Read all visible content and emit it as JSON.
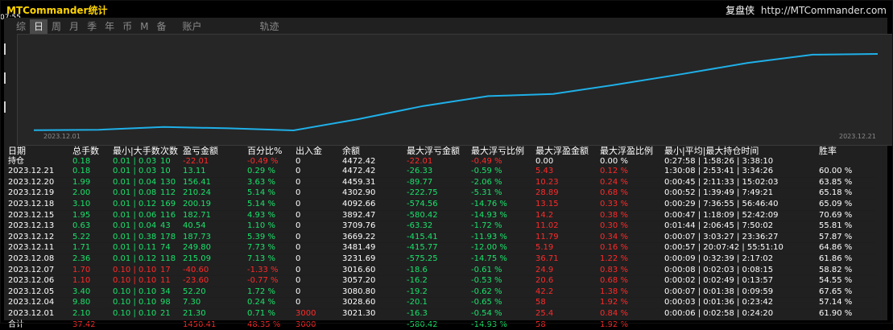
{
  "window": {
    "title": "MTCommander统计",
    "clock": "07:55",
    "brand_cn": "复盘侠",
    "brand_url": "http://MTCommander.com"
  },
  "tabs": [
    {
      "label": "综",
      "active": false
    },
    {
      "label": "日",
      "active": true
    },
    {
      "label": "周",
      "active": false
    },
    {
      "label": "月",
      "active": false
    },
    {
      "label": "季",
      "active": false
    },
    {
      "label": "年",
      "active": false
    },
    {
      "label": "币",
      "active": false
    },
    {
      "label": "M",
      "active": false
    },
    {
      "label": "备",
      "active": false
    },
    {
      "label": "账户",
      "active": false
    },
    {
      "label": "轨迹",
      "active": false
    }
  ],
  "chart": {
    "start_label": "2023.12.01",
    "end_label": "2023.12.21",
    "line_color": "#1fb0e8"
  },
  "chart_data": {
    "type": "line",
    "x": [
      "2023.12.01",
      "2023.12.04",
      "2023.12.05",
      "2023.12.06",
      "2023.12.07",
      "2023.12.08",
      "2023.12.11",
      "2023.12.12",
      "2023.12.13",
      "2023.12.15",
      "2023.12.18",
      "2023.12.19",
      "2023.12.20",
      "2023.12.21"
    ],
    "values": [
      3021.3,
      3028.6,
      3080.8,
      3057.2,
      3016.6,
      3231.69,
      3481.49,
      3669.22,
      3709.76,
      3892.47,
      4092.66,
      4302.9,
      4459.31,
      4472.42
    ]
  },
  "table": {
    "headers": {
      "date": "日期",
      "total": "总手数",
      "minmax": "最小|大手数",
      "count": "次数",
      "pl": "盈亏金额",
      "pct": "百分比%",
      "io": "出入金",
      "balance": "余额",
      "maxloss": "最大浮亏金额",
      "maxlossp": "最大浮亏比例",
      "maxwin": "最大浮盈金额",
      "maxwinp": "最大浮盈比例",
      "time": "最小|平均|最大持仓时间",
      "rate": "胜率"
    },
    "position_row": {
      "date": "持仓",
      "total": "0.18",
      "minmax": "0.01 | 0.03",
      "count": "10",
      "pl": "-22.01",
      "pct": "-0.49 %",
      "io": "0",
      "balance": "4472.42",
      "maxloss": "-22.01",
      "maxlossp": "-0.49 %",
      "maxwin": "0.00",
      "maxwinp": "0.00 %",
      "time": "0:27:58 | 1:58:26 | 3:38:10",
      "rate": ""
    },
    "rows": [
      {
        "date": "2023.12.21",
        "total": "0.18",
        "minmax": "0.01 | 0.03",
        "count": "10",
        "pl": "13.11",
        "pct": "0.29 %",
        "io": "0",
        "balance": "4472.42",
        "maxloss": "-26.33",
        "maxlossp": "-0.59 %",
        "maxwin": "5.43",
        "maxwinp": "0.12 %",
        "time": "1:30:08 | 2:53:41 | 3:34:26",
        "rate": "60.00 %"
      },
      {
        "date": "2023.12.20",
        "total": "1.99",
        "minmax": "0.01 | 0.04",
        "count": "130",
        "pl": "156.41",
        "pct": "3.63 %",
        "io": "0",
        "balance": "4459.31",
        "maxloss": "-89.77",
        "maxlossp": "-2.06 %",
        "maxwin": "10.23",
        "maxwinp": "0.24 %",
        "time": "0:00:45 | 2:11:33 | 15:02:03",
        "rate": "63.85 %"
      },
      {
        "date": "2023.12.19",
        "total": "2.00",
        "minmax": "0.01 | 0.08",
        "count": "112",
        "pl": "210.24",
        "pct": "5.14 %",
        "io": "0",
        "balance": "4302.90",
        "maxloss": "-222.75",
        "maxlossp": "-5.31 %",
        "maxwin": "28.89",
        "maxwinp": "0.68 %",
        "time": "0:00:52 | 1:39:49 | 7:49:21",
        "rate": "65.18 %"
      },
      {
        "date": "2023.12.18",
        "total": "3.10",
        "minmax": "0.01 | 0.12",
        "count": "169",
        "pl": "200.19",
        "pct": "5.14 %",
        "io": "0",
        "balance": "4092.66",
        "maxloss": "-574.56",
        "maxlossp": "-14.76 %",
        "maxwin": "13.15",
        "maxwinp": "0.33 %",
        "time": "0:00:29 | 7:36:55 | 56:46:40",
        "rate": "65.09 %"
      },
      {
        "date": "2023.12.15",
        "total": "1.95",
        "minmax": "0.01 | 0.06",
        "count": "116",
        "pl": "182.71",
        "pct": "4.93 %",
        "io": "0",
        "balance": "3892.47",
        "maxloss": "-580.42",
        "maxlossp": "-14.93 %",
        "maxwin": "14.2",
        "maxwinp": "0.38 %",
        "time": "0:00:47 | 1:18:09 | 52:42:09",
        "rate": "70.69 %"
      },
      {
        "date": "2023.12.13",
        "total": "0.63",
        "minmax": "0.01 | 0.04",
        "count": "43",
        "pl": "40.54",
        "pct": "1.10 %",
        "io": "0",
        "balance": "3709.76",
        "maxloss": "-63.32",
        "maxlossp": "-1.72 %",
        "maxwin": "11.02",
        "maxwinp": "0.30 %",
        "time": "0:01:44 | 2:06:45 | 7:50:02",
        "rate": "55.81 %"
      },
      {
        "date": "2023.12.12",
        "total": "5.22",
        "minmax": "0.01 | 0.38",
        "count": "178",
        "pl": "187.73",
        "pct": "5.39 %",
        "io": "0",
        "balance": "3669.22",
        "maxloss": "-415.41",
        "maxlossp": "-11.93 %",
        "maxwin": "11.79",
        "maxwinp": "0.34 %",
        "time": "0:00:07 | 3:03:27 | 23:36:27",
        "rate": "57.87 %"
      },
      {
        "date": "2023.12.11",
        "total": "1.71",
        "minmax": "0.01 | 0.11",
        "count": "74",
        "pl": "249.80",
        "pct": "7.73 %",
        "io": "0",
        "balance": "3481.49",
        "maxloss": "-415.77",
        "maxlossp": "-12.00 %",
        "maxwin": "5.19",
        "maxwinp": "0.16 %",
        "time": "0:00:57 | 20:07:42 | 55:51:10",
        "rate": "64.86 %"
      },
      {
        "date": "2023.12.08",
        "total": "2.36",
        "minmax": "0.01 | 0.12",
        "count": "118",
        "pl": "215.09",
        "pct": "7.13 %",
        "io": "0",
        "balance": "3231.69",
        "maxloss": "-575.25",
        "maxlossp": "-14.75 %",
        "maxwin": "36.71",
        "maxwinp": "1.22 %",
        "time": "0:00:09 | 0:32:39 | 2:17:02",
        "rate": "61.86 %"
      },
      {
        "date": "2023.12.07",
        "total": "1.70",
        "minmax": "0.10 | 0.10",
        "count": "17",
        "pl": "-40.60",
        "pct": "-1.33 %",
        "io": "0",
        "balance": "3016.60",
        "maxloss": "-18.6",
        "maxlossp": "-0.61 %",
        "maxwin": "24.9",
        "maxwinp": "0.83 %",
        "time": "0:00:08 | 0:02:03 | 0:08:15",
        "rate": "58.82 %"
      },
      {
        "date": "2023.12.06",
        "total": "1.10",
        "minmax": "0.10 | 0.10",
        "count": "11",
        "pl": "-23.60",
        "pct": "-0.77 %",
        "io": "0",
        "balance": "3057.20",
        "maxloss": "-16.2",
        "maxlossp": "-0.53 %",
        "maxwin": "20.6",
        "maxwinp": "0.68 %",
        "time": "0:00:02 | 0:02:49 | 0:13:57",
        "rate": "54.55 %"
      },
      {
        "date": "2023.12.05",
        "total": "3.40",
        "minmax": "0.10 | 0.10",
        "count": "34",
        "pl": "52.20",
        "pct": "1.72 %",
        "io": "0",
        "balance": "3080.80",
        "maxloss": "-19.2",
        "maxlossp": "-0.62 %",
        "maxwin": "42.2",
        "maxwinp": "1.38 %",
        "time": "0:00:07 | 0:01:38 | 0:09:59",
        "rate": "67.65 %"
      },
      {
        "date": "2023.12.04",
        "total": "9.80",
        "minmax": "0.10 | 0.10",
        "count": "98",
        "pl": "7.30",
        "pct": "0.24 %",
        "io": "0",
        "balance": "3028.60",
        "maxloss": "-20.1",
        "maxlossp": "-0.65 %",
        "maxwin": "58",
        "maxwinp": "1.92 %",
        "time": "0:00:03 | 0:01:36 | 0:23:42",
        "rate": "57.14 %"
      },
      {
        "date": "2023.12.01",
        "total": "2.10",
        "minmax": "0.10 | 0.10",
        "count": "21",
        "pl": "21.30",
        "pct": "0.71 %",
        "io": "3000",
        "balance": "3021.30",
        "maxloss": "-16.3",
        "maxlossp": "-0.54 %",
        "maxwin": "25.4",
        "maxwinp": "0.84 %",
        "time": "0:00:06 | 0:02:58 | 0:24:20",
        "rate": "61.90 %"
      }
    ],
    "sum_row": {
      "date": "合计",
      "total": "37.42",
      "pl": "1450.41",
      "pct": "48.35 %",
      "io": "3000",
      "maxloss": "-580.42",
      "maxlossp": "-14.93 %",
      "maxwin": "58",
      "maxwinp": "1.92 %"
    }
  },
  "colors": {
    "positive": "#19e36b",
    "negative": "#ff2a2a",
    "title": "#ffd400"
  }
}
